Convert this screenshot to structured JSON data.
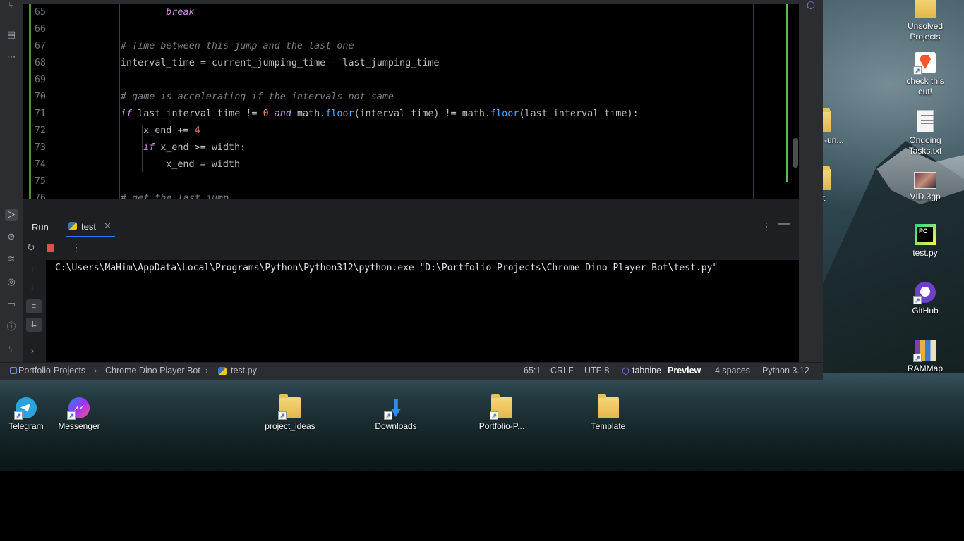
{
  "editor": {
    "lines": [
      {
        "n": "65",
        "indent": 5,
        "tokens": [
          {
            "t": "break",
            "c": "kw"
          }
        ]
      },
      {
        "n": "66",
        "indent": 0,
        "tokens": []
      },
      {
        "n": "67",
        "indent": 3,
        "tokens": [
          {
            "t": "# Time between this jump and the last one",
            "c": "cm"
          }
        ]
      },
      {
        "n": "68",
        "indent": 3,
        "tokens": [
          {
            "t": "interval_time = current_jumping_time - last_jumping_time",
            "c": ""
          }
        ]
      },
      {
        "n": "69",
        "indent": 0,
        "tokens": []
      },
      {
        "n": "70",
        "indent": 3,
        "tokens": [
          {
            "t": "# game is accelerating if the intervals not same",
            "c": "cm"
          }
        ]
      },
      {
        "n": "71",
        "indent": 3,
        "tokens": [
          {
            "t": "if",
            "c": "kw"
          },
          {
            "t": " last_interval_time != ",
            "c": ""
          },
          {
            "t": "0",
            "c": "nm"
          },
          {
            "t": " ",
            "c": ""
          },
          {
            "t": "and",
            "c": "kw"
          },
          {
            "t": " math.",
            "c": ""
          },
          {
            "t": "floor",
            "c": "fn"
          },
          {
            "t": "(interval_time) != math.",
            "c": ""
          },
          {
            "t": "floor",
            "c": "fn"
          },
          {
            "t": "(last_interval_time):",
            "c": ""
          }
        ]
      },
      {
        "n": "72",
        "indent": 4,
        "tokens": [
          {
            "t": "x_end += ",
            "c": ""
          },
          {
            "t": "4",
            "c": "nm"
          }
        ]
      },
      {
        "n": "73",
        "indent": 4,
        "tokens": [
          {
            "t": "if",
            "c": "kw"
          },
          {
            "t": " x_end >= width:",
            "c": ""
          }
        ]
      },
      {
        "n": "74",
        "indent": 5,
        "tokens": [
          {
            "t": "x_end = width",
            "c": ""
          }
        ]
      },
      {
        "n": "75",
        "indent": 0,
        "tokens": []
      },
      {
        "n": "76",
        "indent": 3,
        "tokens": [
          {
            "t": "# get the last jump",
            "c": "cm"
          }
        ]
      }
    ]
  },
  "run": {
    "tab_label": "Run",
    "file_tab": "test",
    "console": "C:\\Users\\MaHim\\AppData\\Local\\Programs\\Python\\Python312\\python.exe \"D:\\Portfolio-Projects\\Chrome Dino Player Bot\\test.py\""
  },
  "breadcrumb": {
    "project": "Portfolio-Projects",
    "folder": "Chrome Dino Player Bot",
    "file": "test.py"
  },
  "status": {
    "position": "65:1",
    "line_sep": "CRLF",
    "encoding": "UTF-8",
    "tabnine": "tabnine",
    "tabnine_mode": "Preview",
    "indent": "4 spaces",
    "interpreter": "Python 3.12"
  },
  "desktop": {
    "right_icons": [
      {
        "label": "Unsolved\nProjects",
        "kind": "folder"
      },
      {
        "label": "check this\nout!",
        "kind": "brave"
      },
      {
        "label": "Ongoing\nTasks.txt",
        "kind": "doc"
      },
      {
        "label": "VID.3gp",
        "kind": "video"
      },
      {
        "label": "test.py",
        "kind": "pycharm"
      },
      {
        "label": "GitHub",
        "kind": "github"
      },
      {
        "label": "RAMMap",
        "kind": "rammap"
      }
    ],
    "partial_labels": [
      "-un...",
      "t"
    ],
    "bottom_icons": [
      {
        "label": "Telegram",
        "kind": "telegram"
      },
      {
        "label": "Messenger",
        "kind": "messenger"
      },
      {
        "label": "project_ideas",
        "kind": "folder"
      },
      {
        "label": "Downloads",
        "kind": "downloads"
      },
      {
        "label": "Portfolio-P...",
        "kind": "folder"
      },
      {
        "label": "Template",
        "kind": "folder"
      }
    ]
  },
  "colors": {
    "accent": "#3574f0",
    "keyword": "#cf8ee0",
    "comment": "#7a7e85",
    "number": "#e6896d",
    "function": "#57aaf7"
  }
}
